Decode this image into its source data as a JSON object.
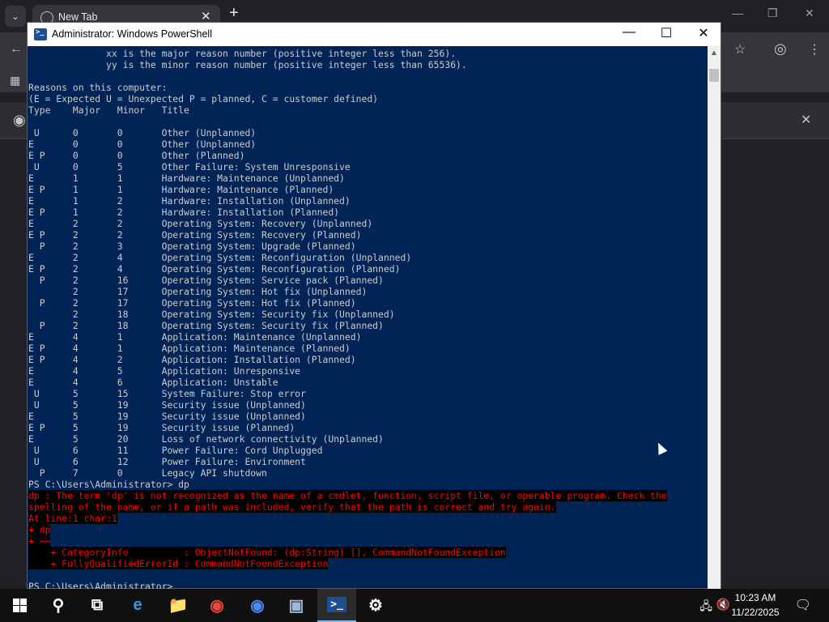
{
  "browser": {
    "tab_title": "New Tab",
    "tab_close": "✕",
    "new_tab": "+",
    "tab_search": "⌄",
    "infobar_close": "✕"
  },
  "powershell": {
    "title": "Administrator: Windows PowerShell",
    "controls": {
      "minimize": "—",
      "maximize": "☐",
      "close": "✕"
    },
    "lines": [
      {
        "t": "              xx is the major reason number (positive integer less than 256).",
        "err": false
      },
      {
        "t": "              yy is the minor reason number (positive integer less than 65536).",
        "err": false
      },
      {
        "t": "",
        "err": false
      },
      {
        "t": "Reasons on this computer:",
        "err": false
      },
      {
        "t": "(E = Expected U = Unexpected P = planned, C = customer defined)",
        "err": false
      },
      {
        "t": "Type    Major   Minor   Title",
        "err": false
      },
      {
        "t": "",
        "err": false
      },
      {
        "t": " U      0       0       Other (Unplanned)",
        "err": false
      },
      {
        "t": "E       0       0       Other (Unplanned)",
        "err": false
      },
      {
        "t": "E P     0       0       Other (Planned)",
        "err": false
      },
      {
        "t": " U      0       5       Other Failure: System Unresponsive",
        "err": false
      },
      {
        "t": "E       1       1       Hardware: Maintenance (Unplanned)",
        "err": false
      },
      {
        "t": "E P     1       1       Hardware: Maintenance (Planned)",
        "err": false
      },
      {
        "t": "E       1       2       Hardware: Installation (Unplanned)",
        "err": false
      },
      {
        "t": "E P     1       2       Hardware: Installation (Planned)",
        "err": false
      },
      {
        "t": "E       2       2       Operating System: Recovery (Unplanned)",
        "err": false
      },
      {
        "t": "E P     2       2       Operating System: Recovery (Planned)",
        "err": false
      },
      {
        "t": "  P     2       3       Operating System: Upgrade (Planned)",
        "err": false
      },
      {
        "t": "E       2       4       Operating System: Reconfiguration (Unplanned)",
        "err": false
      },
      {
        "t": "E P     2       4       Operating System: Reconfiguration (Planned)",
        "err": false
      },
      {
        "t": "  P     2       16      Operating System: Service pack (Planned)",
        "err": false
      },
      {
        "t": "        2       17      Operating System: Hot fix (Unplanned)",
        "err": false
      },
      {
        "t": "  P     2       17      Operating System: Hot fix (Planned)",
        "err": false
      },
      {
        "t": "        2       18      Operating System: Security fix (Unplanned)",
        "err": false
      },
      {
        "t": "  P     2       18      Operating System: Security fix (Planned)",
        "err": false
      },
      {
        "t": "E       4       1       Application: Maintenance (Unplanned)",
        "err": false
      },
      {
        "t": "E P     4       1       Application: Maintenance (Planned)",
        "err": false
      },
      {
        "t": "E P     4       2       Application: Installation (Planned)",
        "err": false
      },
      {
        "t": "E       4       5       Application: Unresponsive",
        "err": false
      },
      {
        "t": "E       4       6       Application: Unstable",
        "err": false
      },
      {
        "t": " U      5       15      System Failure: Stop error",
        "err": false
      },
      {
        "t": " U      5       19      Security issue (Unplanned)",
        "err": false
      },
      {
        "t": "E       5       19      Security issue (Unplanned)",
        "err": false
      },
      {
        "t": "E P     5       19      Security issue (Planned)",
        "err": false
      },
      {
        "t": "E       5       20      Loss of network connectivity (Unplanned)",
        "err": false
      },
      {
        "t": " U      6       11      Power Failure: Cord Unplugged",
        "err": false
      },
      {
        "t": " U      6       12      Power Failure: Environment",
        "err": false
      },
      {
        "t": "  P     7       0       Legacy API shutdown",
        "err": false
      },
      {
        "t": "PS C:\\Users\\Administrator> dp",
        "err": false
      },
      {
        "t": "dp : The term 'dp' is not recognized as the name of a cmdlet, function, script file, or operable program. Check the",
        "err": true
      },
      {
        "t": "spelling of the name, or if a path was included, verify that the path is correct and try again.",
        "err": true
      },
      {
        "t": "At line:1 char:1",
        "err": true
      },
      {
        "t": "+ dp",
        "err": true
      },
      {
        "t": "+ ~~",
        "err": true
      },
      {
        "t": "    + CategoryInfo          : ObjectNotFound: (dp:String) [], CommandNotFoundException",
        "err": true
      },
      {
        "t": "    + FullyQualifiedErrorId : CommandNotFoundException",
        "err": true
      },
      {
        "t": "",
        "err": true
      },
      {
        "t": "PS C:\\Users\\Administrator>",
        "err": false
      }
    ]
  },
  "taskbar": {
    "apps": [
      {
        "name": "search-button",
        "icon": "search-icon",
        "glyph": "⚲"
      },
      {
        "name": "task-view-button",
        "icon": "task-view-icon",
        "glyph": "⧉"
      },
      {
        "name": "edge-app",
        "icon": "edge-icon",
        "glyph": "e"
      },
      {
        "name": "file-explorer-app",
        "icon": "folder-icon",
        "glyph": "📁"
      },
      {
        "name": "chrome-app",
        "icon": "chrome-icon",
        "glyph": "◉"
      },
      {
        "name": "chromium-app",
        "icon": "chromium-icon",
        "glyph": "◉"
      },
      {
        "name": "server-manager-app",
        "icon": "server-manager-icon",
        "glyph": "▣"
      },
      {
        "name": "powershell-app",
        "icon": "powershell-icon",
        "glyph": ">_"
      },
      {
        "name": "settings-app",
        "icon": "gear-icon",
        "glyph": "⚙"
      }
    ],
    "time": "10:23 AM",
    "date": "11/22/2025"
  },
  "colors": {
    "ps_background": "#012456",
    "ps_text": "#cccccc",
    "ps_error": "#ff0000",
    "taskbar": "#101010",
    "accent": "#76b9ed"
  }
}
